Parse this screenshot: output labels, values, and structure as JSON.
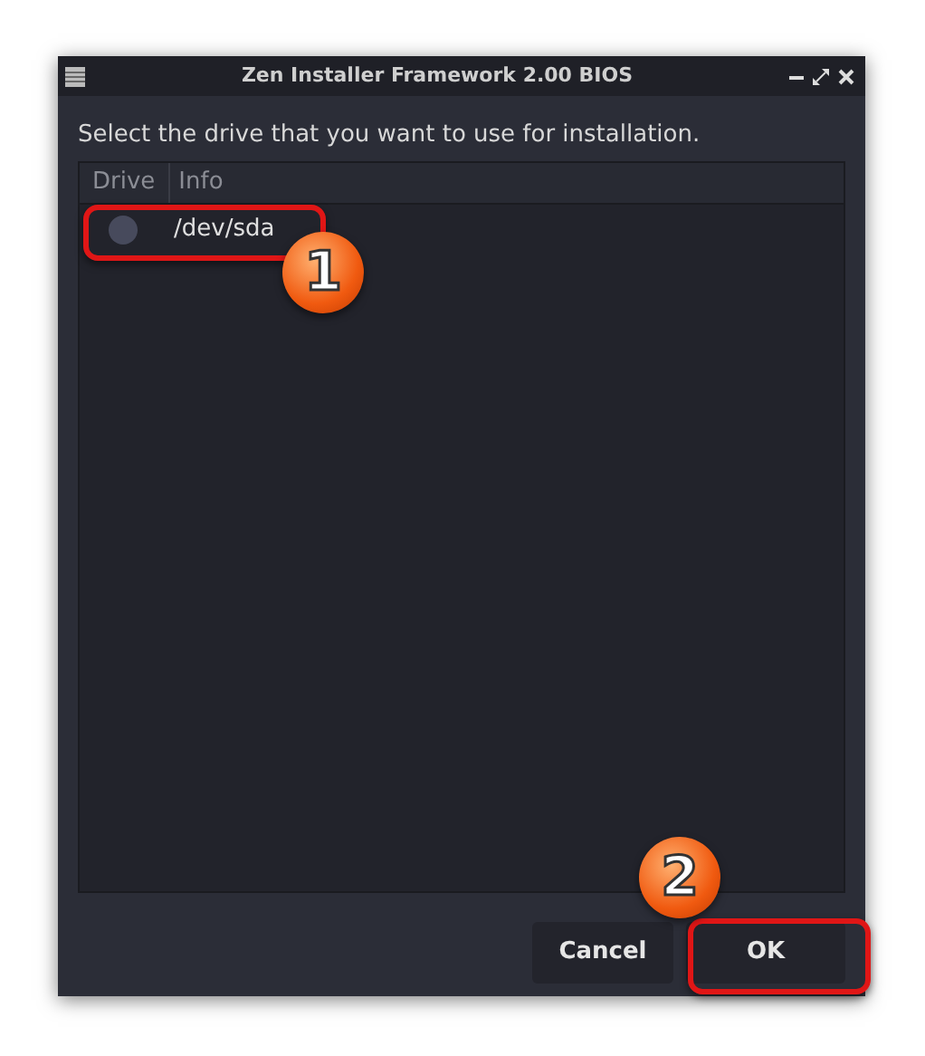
{
  "window": {
    "title": "Zen Installer Framework 2.00 BIOS"
  },
  "prompt": "Select the drive that you want to use for installation.",
  "table": {
    "columns": [
      "Drive",
      "Info"
    ],
    "rows": [
      {
        "selected": false,
        "info": "/dev/sda"
      }
    ]
  },
  "buttons": [
    {
      "label": "Cancel",
      "kind": "normal"
    },
    {
      "label": "OK",
      "kind": "default"
    }
  ],
  "callouts": [
    {
      "label": "1",
      "kind": "row"
    },
    {
      "label": "2",
      "kind": "button"
    }
  ]
}
